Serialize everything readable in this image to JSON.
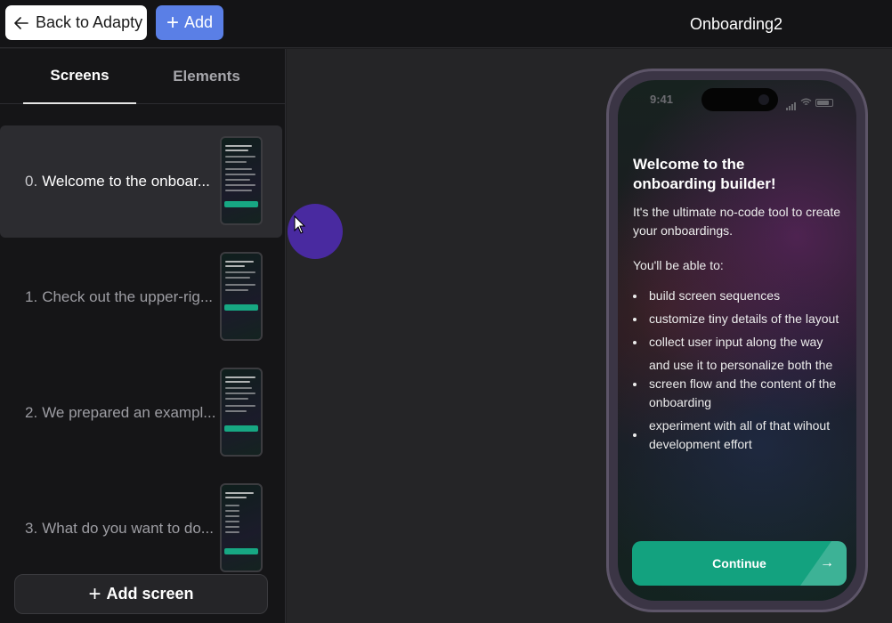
{
  "topbar": {
    "back_label": "Back to Adapty",
    "add_label": "Add",
    "title": "Onboarding2"
  },
  "sidebar": {
    "tabs": [
      {
        "label": "Screens",
        "active": true
      },
      {
        "label": "Elements",
        "active": false
      }
    ],
    "screens": [
      {
        "number": "0.",
        "title": "Welcome to the onboar...",
        "active": true
      },
      {
        "number": "1.",
        "title": "Check out the upper-rig...",
        "active": false
      },
      {
        "number": "2.",
        "title": "We prepared an exampl...",
        "active": false
      },
      {
        "number": "3.",
        "title": "What do you want to do...",
        "active": false
      }
    ],
    "add_screen_label": "Add screen"
  },
  "preview": {
    "status_time": "9:41",
    "title": "Welcome to the onboarding builder!",
    "subtitle": "It's the ultimate no-code tool to create your onboardings.",
    "list_intro": "You'll be able to:",
    "list": [
      "build screen sequences",
      "customize tiny details of the layout",
      "collect user input along the way",
      "and use it to personalize both the screen flow and the content of the onboarding",
      "experiment with all of that wihout development effort"
    ],
    "cta_label": "Continue",
    "cta_color": "#13a27f"
  },
  "colors": {
    "accent": "#5a7fe6",
    "cursor_highlight": "#4b2aa6"
  }
}
